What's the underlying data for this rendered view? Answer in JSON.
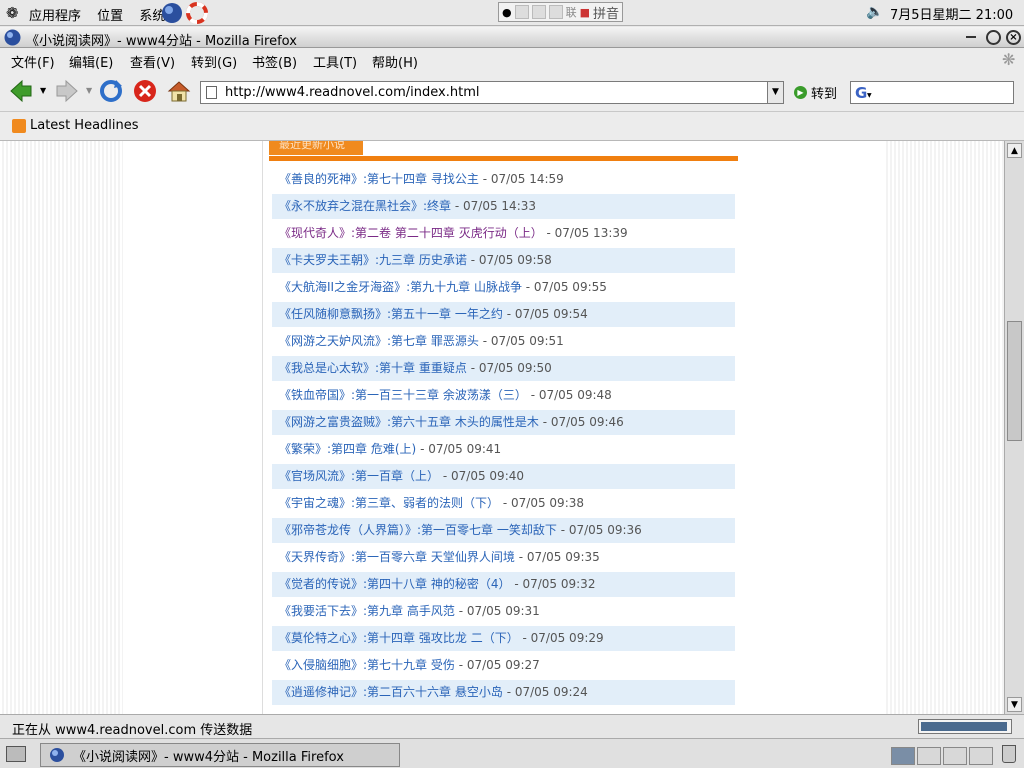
{
  "top_panel": {
    "menus": [
      "应用程序",
      "位置",
      "系统"
    ],
    "ime_label": "拼音",
    "ime_mode": "联",
    "clock": "7月5日星期二 21:00"
  },
  "window": {
    "title": "《小说阅读网》- www4分站 - Mozilla Firefox"
  },
  "menubar": [
    "文件(F)",
    "编辑(E)",
    "查看(V)",
    "转到(G)",
    "书签(B)",
    "工具(T)",
    "帮助(H)"
  ],
  "navbar": {
    "url": "http://www4.readnovel.com/index.html",
    "go_label": "转到"
  },
  "bookmarks": {
    "item": "Latest Headlines"
  },
  "content": {
    "section_tab": "最近更新小说",
    "updates": [
      {
        "title": "《善良的死神》",
        "chapter": ":第七十四章 寻找公主",
        "time": " - 07/05 14:59"
      },
      {
        "title": "《永不放弃之混在黑社会》",
        "chapter": ":终章",
        "time": " - 07/05 14:33"
      },
      {
        "title": "《现代奇人》",
        "chapter": ":第二卷 第二十四章 灭虎行动（上）",
        "time": " - 07/05 13:39"
      },
      {
        "title": "《卡夫罗夫王朝》",
        "chapter": ":九三章 历史承诺",
        "time": " - 07/05 09:58"
      },
      {
        "title": "《大航海II之金牙海盗》",
        "chapter": ":第九十九章 山脉战争",
        "time": " - 07/05 09:55"
      },
      {
        "title": "《任风随柳意飘扬》",
        "chapter": ":第五十一章 一年之约",
        "time": " - 07/05 09:54"
      },
      {
        "title": "《网游之天妒风流》",
        "chapter": ":第七章 罪恶源头",
        "time": " - 07/05 09:51"
      },
      {
        "title": "《我总是心太软》",
        "chapter": ":第十章 重重疑点",
        "time": " - 07/05 09:50"
      },
      {
        "title": "《铁血帝国》",
        "chapter": ":第一百三十三章 余波荡漾（三）",
        "time": " - 07/05 09:48"
      },
      {
        "title": "《网游之富贵盗贼》",
        "chapter": ":第六十五章 木头的属性是木",
        "time": " - 07/05 09:46"
      },
      {
        "title": "《繁荣》",
        "chapter": ":第四章 危难(上)",
        "time": " - 07/05 09:41"
      },
      {
        "title": "《官场风流》",
        "chapter": ":第一百章（上）",
        "time": " - 07/05 09:40"
      },
      {
        "title": "《宇宙之魂》",
        "chapter": ":第三章、弱者的法则（下）",
        "time": " - 07/05 09:38"
      },
      {
        "title": "《邪帝苍龙传（人界篇）》",
        "chapter": ":第一百零七章 一笑却敌下",
        "time": " - 07/05 09:36"
      },
      {
        "title": "《天界传奇》",
        "chapter": ":第一百零六章 天堂仙界人间境",
        "time": " - 07/05 09:35"
      },
      {
        "title": "《觉者的传说》",
        "chapter": ":第四十八章 神的秘密（4）",
        "time": " - 07/05 09:32"
      },
      {
        "title": "《我要活下去》",
        "chapter": ":第九章 高手风范",
        "time": " - 07/05 09:31"
      },
      {
        "title": "《莫伦特之心》",
        "chapter": ":第十四章 强攻比龙 二（下）",
        "time": " - 07/05 09:29"
      },
      {
        "title": "《入侵脑细胞》",
        "chapter": ":第七十九章 受伤",
        "time": " - 07/05 09:27"
      },
      {
        "title": "《逍遥修神记》",
        "chapter": ":第二百六十六章 悬空小岛",
        "time": " - 07/05 09:24"
      }
    ]
  },
  "statusbar": {
    "text": "正在从 www4.readnovel.com 传送数据"
  },
  "taskbar": {
    "task": "《小说阅读网》- www4分站 - Mozilla Firefox"
  },
  "colors": {
    "accent_orange": "#f07f10",
    "link_blue": "#2a64b8",
    "row_alt": "#e2eef9"
  }
}
